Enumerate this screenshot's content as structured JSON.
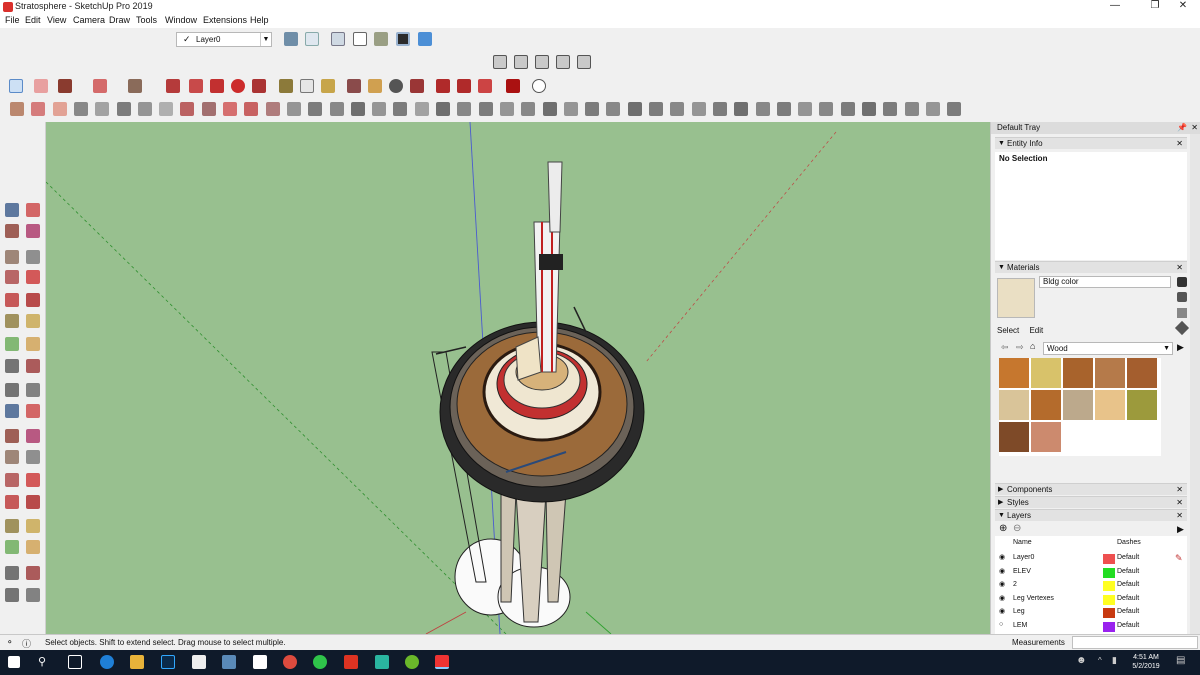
{
  "window": {
    "title": "Stratosphere - SketchUp Pro 2019"
  },
  "menu": [
    "File",
    "Edit",
    "View",
    "Camera",
    "Draw",
    "Tools",
    "Window",
    "Extensions",
    "Help"
  ],
  "layers_toolbar": {
    "current_layer": "Layer0"
  },
  "tray": {
    "title": "Default Tray",
    "entity_info": {
      "title": "Entity Info",
      "selection": "No Selection"
    },
    "materials": {
      "title": "Materials",
      "current_material": "Bldg color",
      "tabs": [
        "Select",
        "Edit"
      ],
      "collection": "Wood",
      "swatches": [
        "#c6772e",
        "#d8c26a",
        "#a8632c",
        "#b57a4a",
        "#a45e2e",
        "#d9c499",
        "#b46b2c",
        "#bca98c",
        "#e8c38a",
        "#9c9a3c",
        "#7e4a28",
        "#cc8a6e"
      ]
    },
    "components_title": "Components",
    "styles_title": "Styles",
    "layers": {
      "title": "Layers",
      "col_name": "Name",
      "col_dashes": "Dashes",
      "rows": [
        {
          "name": "Layer0",
          "color": "#ee5050",
          "dashes": "Default",
          "visible": true
        },
        {
          "name": "ELEV",
          "color": "#22dd22",
          "dashes": "Default",
          "visible": true
        },
        {
          "name": "2",
          "color": "#ffff22",
          "dashes": "Default",
          "visible": true
        },
        {
          "name": "Leg Vertexes",
          "color": "#ffff22",
          "dashes": "Default",
          "visible": true
        },
        {
          "name": "Leg",
          "color": "#c83a10",
          "dashes": "Default",
          "visible": true
        },
        {
          "name": "LEM",
          "color": "#9922ee",
          "dashes": "Default",
          "visible": false
        }
      ]
    }
  },
  "status": {
    "hint": "Select objects. Shift to extend select. Drag mouse to select multiple.",
    "measurements_label": "Measurements",
    "measurements_value": ""
  },
  "taskbar": {
    "time": "4:51 AM",
    "date": "5/2/2019"
  }
}
